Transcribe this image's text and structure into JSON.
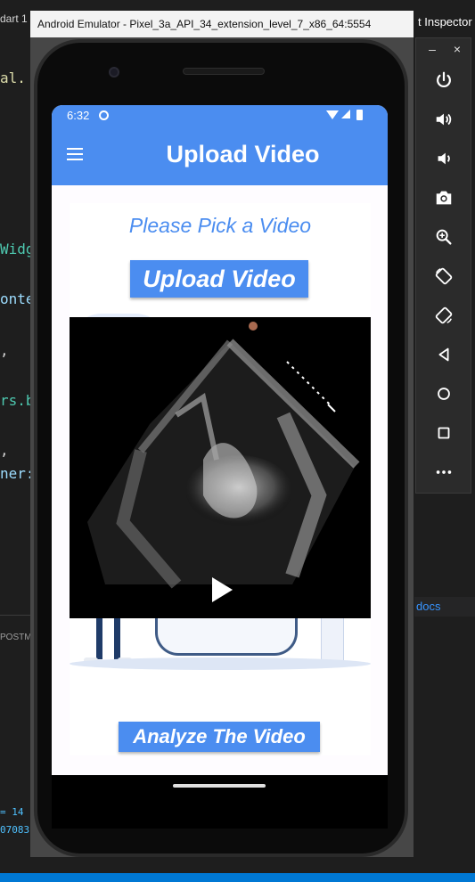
{
  "background": {
    "tab_fragment": "dart 1",
    "code_fragments": [
      "al.",
      "Widg",
      "onte",
      ",",
      "rs.b",
      ",",
      "ner:"
    ],
    "panel_label": "POSTM",
    "bottom_code": [
      "= 14",
      "07083"
    ],
    "inspector_tab": "t Inspector",
    "docs_link": "docs"
  },
  "emulator": {
    "window_title": "Android Emulator - Pixel_3a_API_34_extension_level_7_x86_64:5554",
    "minimize_glyph": "–",
    "close_glyph": "×",
    "tools": [
      "power-icon",
      "volume-up-icon",
      "volume-down-icon",
      "camera-icon",
      "zoom-icon",
      "rotate-left-icon",
      "rotate-right-icon",
      "back-icon",
      "home-icon",
      "overview-icon",
      "more-icon"
    ]
  },
  "statusbar": {
    "time": "6:32"
  },
  "appbar": {
    "title": "Upload Video"
  },
  "main": {
    "prompt": "Please Pick a Video",
    "upload_button": "Upload Video",
    "analyze_button": "Analyze The Video"
  },
  "colors": {
    "primary": "#4b8df0",
    "screen_bg": "#fefcff",
    "video_bg": "#000000"
  }
}
